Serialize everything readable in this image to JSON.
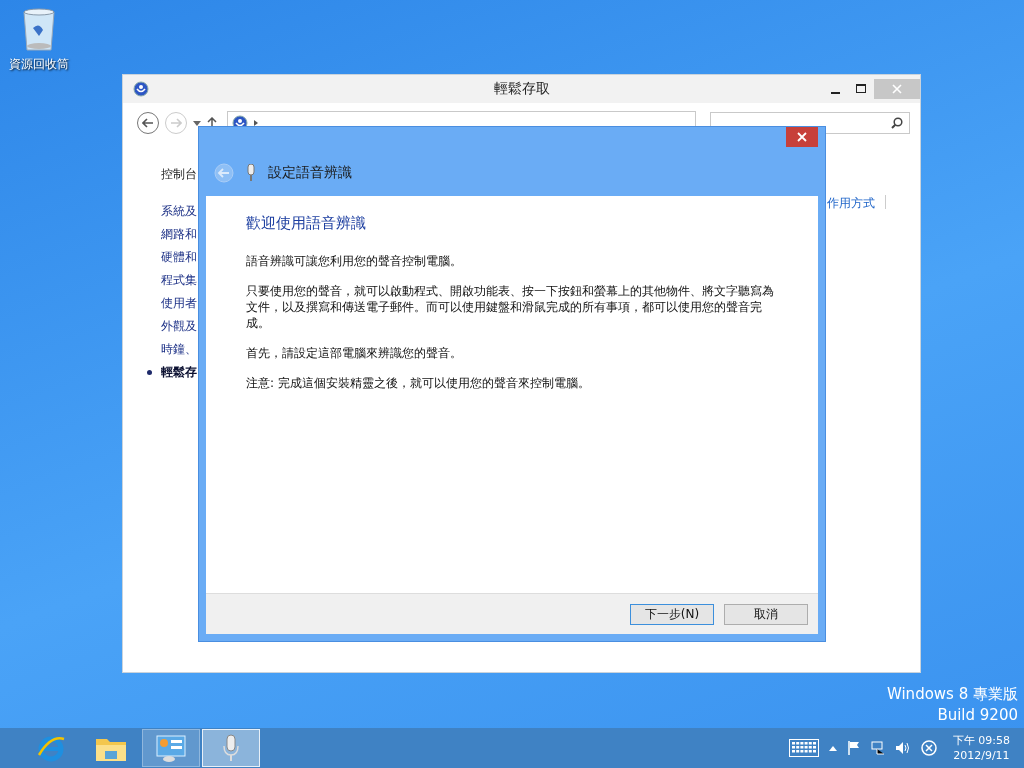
{
  "desktop_icons": [
    {
      "label": "資源回收筒"
    }
  ],
  "window": {
    "title": "輕鬆存取",
    "sidebar": {
      "items": [
        {
          "label": "控制台",
          "selected": false
        },
        {
          "label": "系統及",
          "selected": false
        },
        {
          "label": "網路和",
          "selected": false
        },
        {
          "label": "硬體和",
          "selected": false
        },
        {
          "label": "程式集",
          "selected": false
        },
        {
          "label": "使用者",
          "selected": false
        },
        {
          "label": "外觀及",
          "selected": false
        },
        {
          "label": "時鐘、",
          "selected": false
        },
        {
          "label": "輕鬆存",
          "selected": true
        }
      ]
    },
    "content_link": "作用方式"
  },
  "dialog": {
    "title": "設定語音辨識",
    "heading": "歡迎使用語音辨識",
    "paragraphs": [
      "語音辨識可讓您利用您的聲音控制電腦。",
      "只要使用您的聲音，就可以啟動程式、開啟功能表、按一下按鈕和螢幕上的其他物件、將文字聽寫為文件，以及撰寫和傳送電子郵件。而可以使用鍵盤和滑鼠完成的所有事項，都可以使用您的聲音完成。",
      "首先，請設定這部電腦來辨識您的聲音。",
      "注意: 完成這個安裝精靈之後，就可以使用您的聲音來控制電腦。"
    ],
    "buttons": [
      {
        "label": "下一步(N)",
        "default": true
      },
      {
        "label": "取消",
        "default": false
      }
    ]
  },
  "edition": [
    "Windows 8 專業版",
    "Build 9200"
  ],
  "taskbar": {
    "apps": [
      {
        "kind": "browser",
        "running": false,
        "selected": false
      },
      {
        "kind": "folder",
        "running": false,
        "selected": false
      },
      {
        "kind": "control-panel",
        "running": true,
        "selected": false
      },
      {
        "kind": "microphone",
        "running": true,
        "selected": true
      }
    ],
    "clock": {
      "time": "下午 09:58",
      "date": "2012/9/11"
    }
  }
}
